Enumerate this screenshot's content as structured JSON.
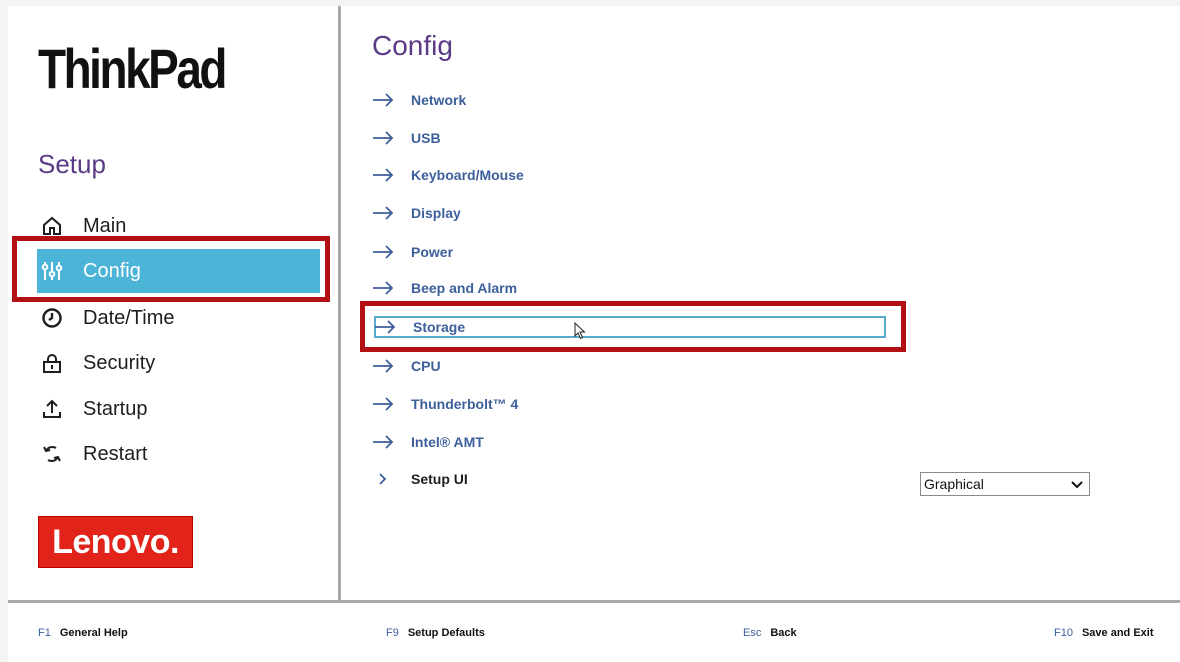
{
  "sidebar": {
    "logo_text": "ThinkPad",
    "setup_title": "Setup",
    "items": [
      {
        "label": "Main",
        "icon": "home-icon"
      },
      {
        "label": "Config",
        "icon": "sliders-icon",
        "active": true
      },
      {
        "label": "Date/Time",
        "icon": "clock-icon"
      },
      {
        "label": "Security",
        "icon": "lock-icon"
      },
      {
        "label": "Startup",
        "icon": "upload-icon"
      },
      {
        "label": "Restart",
        "icon": "refresh-icon"
      }
    ],
    "brand_text": "Lenovo."
  },
  "main": {
    "title": "Config",
    "items": [
      {
        "label": "Network",
        "icon": "arrow-right-icon"
      },
      {
        "label": "USB",
        "icon": "arrow-right-icon"
      },
      {
        "label": "Keyboard/Mouse",
        "icon": "arrow-right-icon"
      },
      {
        "label": "Display",
        "icon": "arrow-right-icon"
      },
      {
        "label": "Power",
        "icon": "arrow-right-icon"
      },
      {
        "label": "Beep and Alarm",
        "icon": "arrow-right-icon"
      },
      {
        "label": "Storage",
        "icon": "arrow-right-icon",
        "focused": true
      },
      {
        "label": "CPU",
        "icon": "arrow-right-icon"
      },
      {
        "label": "Thunderbolt™ 4",
        "icon": "arrow-right-icon"
      },
      {
        "label": "Intel® AMT",
        "icon": "arrow-right-icon"
      }
    ],
    "setup_ui": {
      "label": "Setup UI",
      "icon": "chevron-right-icon",
      "selected_value": "Graphical"
    }
  },
  "footer": [
    {
      "key": "F1",
      "label": "General Help"
    },
    {
      "key": "F9",
      "label": "Setup Defaults"
    },
    {
      "key": "Esc",
      "label": "Back"
    },
    {
      "key": "F10",
      "label": "Save and Exit"
    }
  ],
  "colors": {
    "accent": "#4cb4d6",
    "title": "#5c3b86",
    "link": "#3c5f9b",
    "highlight_box": "#b21015",
    "brand": "#e2231a"
  }
}
